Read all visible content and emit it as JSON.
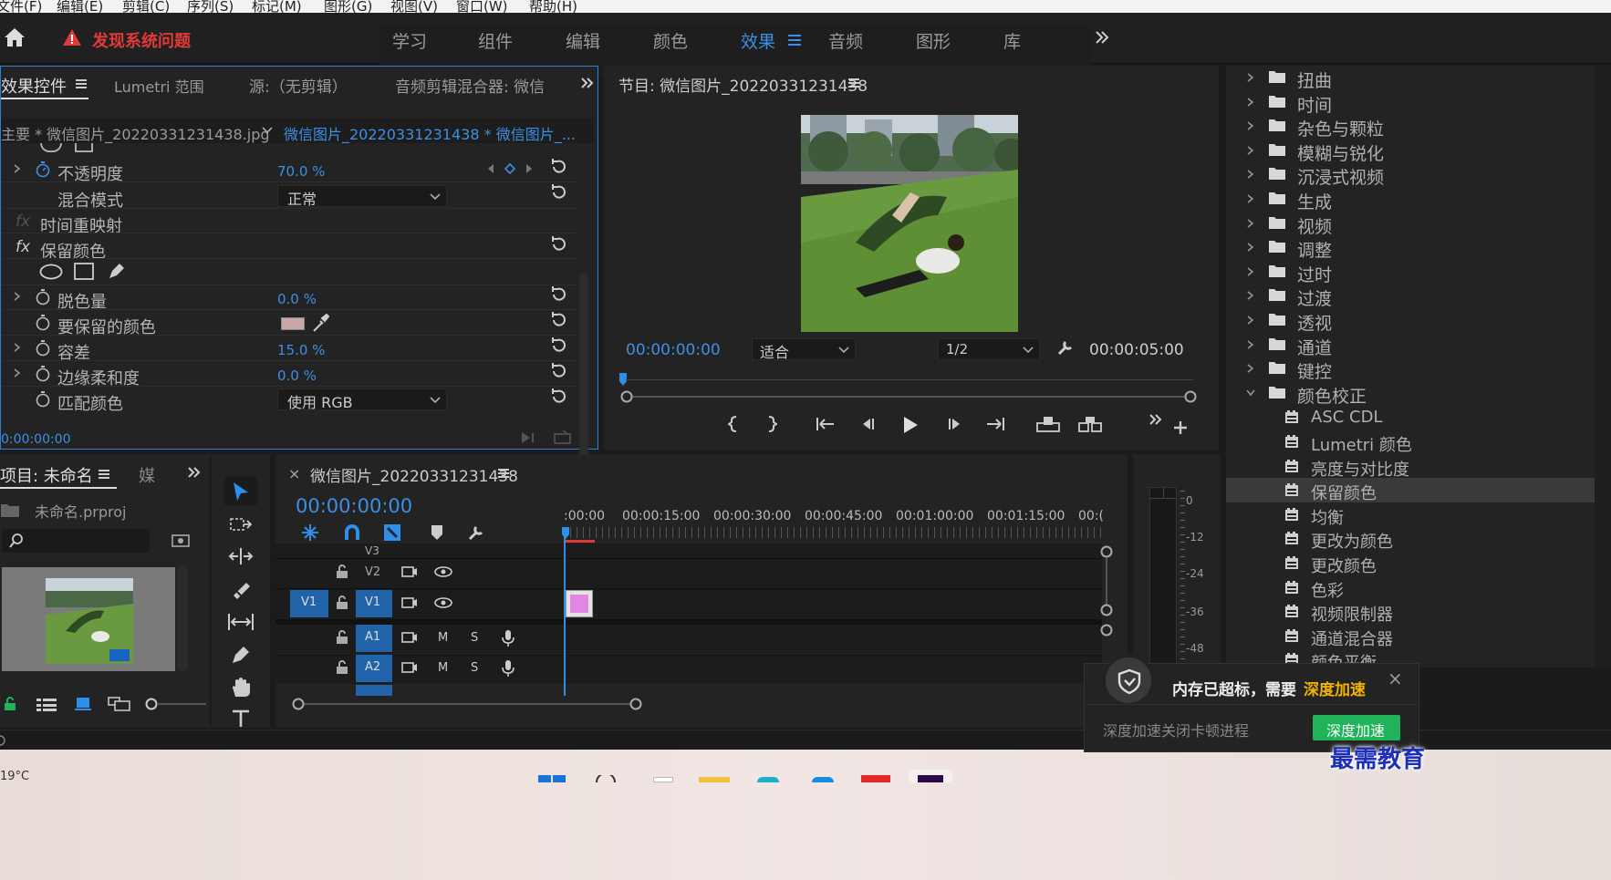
{
  "menubar": {
    "items": [
      "文件(F)",
      "编辑(E)",
      "剪辑(C)",
      "序列(S)",
      "标记(M)",
      "图形(G)",
      "视图(V)",
      "窗口(W)",
      "帮助(H)"
    ]
  },
  "topbar": {
    "alert": "发现系统问题",
    "workspaces": [
      "学习",
      "组件",
      "编辑",
      "颜色",
      "效果",
      "音频",
      "图形",
      "库"
    ],
    "active_workspace": "效果"
  },
  "effect_controls": {
    "tabs": [
      "效果控件",
      "Lumetri 范围",
      "源:（无剪辑）",
      "音频剪辑混合器: 微信"
    ],
    "master_label": "主要 * 微信图片_20220331231438.jpg",
    "clip_label": "微信图片_20220331231438 * 微信图片_...",
    "opacity": {
      "label": "不透明度",
      "value": "70.0 %"
    },
    "blend": {
      "label": "混合模式",
      "value": "正常"
    },
    "time_remap": "时间重映射",
    "keep_color": {
      "label": "保留颜色"
    },
    "params": [
      {
        "label": "脱色量",
        "value": "0.0 %"
      },
      {
        "label": "要保留的颜色",
        "value": ""
      },
      {
        "label": "容差",
        "value": "15.0 %"
      },
      {
        "label": "边缘柔和度",
        "value": "0.0 %"
      },
      {
        "label": "匹配颜色",
        "value": "使用 RGB"
      }
    ],
    "timecode": "0:00:00:00",
    "swatch_color": "#c9a7a7"
  },
  "program": {
    "title": "节目: 微信图片_20220331231438",
    "timecode": "00:00:00:00",
    "fit": "适合",
    "ratio": "1/2",
    "duration": "00:00:05:00"
  },
  "effects_tree": {
    "items": [
      "扭曲",
      "时间",
      "杂色与颗粒",
      "模糊与锐化",
      "沉浸式视频",
      "生成",
      "视频",
      "调整",
      "过时",
      "过渡",
      "透视",
      "通道",
      "键控",
      "颜色校正"
    ],
    "sub_items": [
      "ASC CDL",
      "Lumetri 颜色",
      "亮度与对比度",
      "保留颜色",
      "均衡",
      "更改为颜色",
      "更改颜色",
      "色彩",
      "视频限制器",
      "通道混合器",
      "颜色平衡"
    ],
    "selected": "保留颜色"
  },
  "project": {
    "title": "项目: 未命名",
    "tab2": "媒",
    "file": "未命名.prproj"
  },
  "timeline": {
    "title": "微信图片_20220331231438",
    "timecode": "00:00:00:00",
    "ruler": [
      ":00:00",
      "00:00:15:00",
      "00:00:30:00",
      "00:00:45:00",
      "00:01:00:00",
      "00:01:15:00",
      "00:("
    ],
    "tracks": {
      "v3": "V3",
      "v2": "V2",
      "v1": "V1",
      "src_v1": "V1",
      "a1": "A1",
      "a2": "A2",
      "m": "M",
      "s": "S"
    }
  },
  "meter": {
    "labels": [
      "0",
      "-12",
      "-24",
      "-36",
      "-48"
    ]
  },
  "notification": {
    "text": "内存已超标，需要",
    "highlight": "深度加速",
    "sub": "深度加速关闭卡顿进程",
    "button": "深度加速"
  },
  "watermark": "最需教育",
  "taskbar": {
    "temp": "19°C"
  },
  "colors": {
    "accent": "#2e8fe8",
    "alert": "#e03a3a",
    "notify_green": "#21b35a",
    "highlight": "#f0b400"
  }
}
